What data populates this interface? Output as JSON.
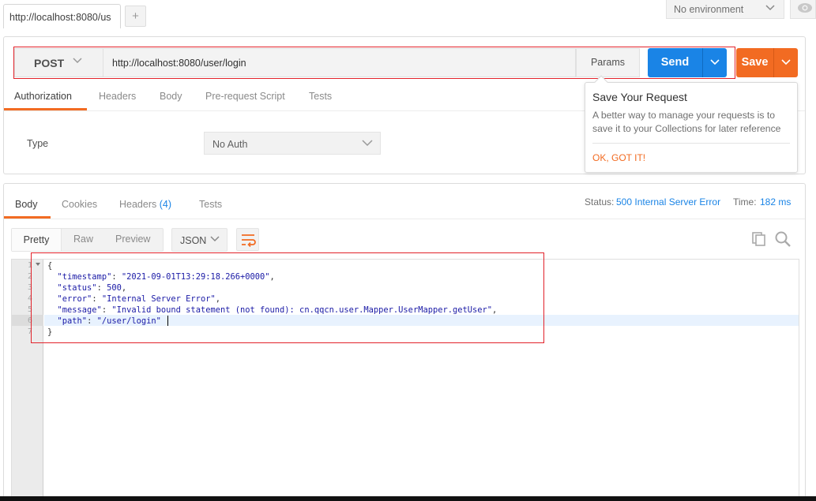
{
  "top": {
    "tab_url": "http://localhost:8080/us",
    "add_tab": "+",
    "environment": "No environment"
  },
  "request": {
    "method": "POST",
    "url": "http://localhost:8080/user/login",
    "params_label": "Params",
    "send_label": "Send",
    "save_label": "Save",
    "tabs": [
      "Authorization",
      "Headers",
      "Body",
      "Pre-request Script",
      "Tests"
    ],
    "auth_type_label": "Type",
    "auth_type_value": "No Auth"
  },
  "popover": {
    "title": "Save Your Request",
    "body": "A better way to manage your requests is to save it to your Collections for later reference",
    "ok": "OK, GOT IT!"
  },
  "response": {
    "tabs": {
      "body": "Body",
      "cookies": "Cookies",
      "headers": "Headers",
      "headers_count": "(4)",
      "tests": "Tests"
    },
    "status_label": "Status:",
    "status_value": "500 Internal Server Error",
    "time_label": "Time:",
    "time_value": "182 ms",
    "view_modes": [
      "Pretty",
      "Raw",
      "Preview"
    ],
    "format": "JSON",
    "line_numbers": [
      "1",
      "2",
      "3",
      "4",
      "5",
      "6",
      "7"
    ],
    "json": {
      "open": "{",
      "timestamp_key": "\"timestamp\"",
      "timestamp_val": "\"2021-09-01T13:29:18.266+0000\"",
      "status_key": "\"status\"",
      "status_val": "500",
      "error_key": "\"error\"",
      "error_val": "\"Internal Server Error\"",
      "message_key": "\"message\"",
      "message_val": "\"Invalid bound statement (not found): cn.qqcn.user.Mapper.UserMapper.getUser\"",
      "path_key": "\"path\"",
      "path_val": "\"/user/login\"",
      "close": "}"
    }
  },
  "colors": {
    "accent_orange": "#f26b22",
    "send_blue": "#1a84e6",
    "highlight_red": "#e2222a"
  }
}
